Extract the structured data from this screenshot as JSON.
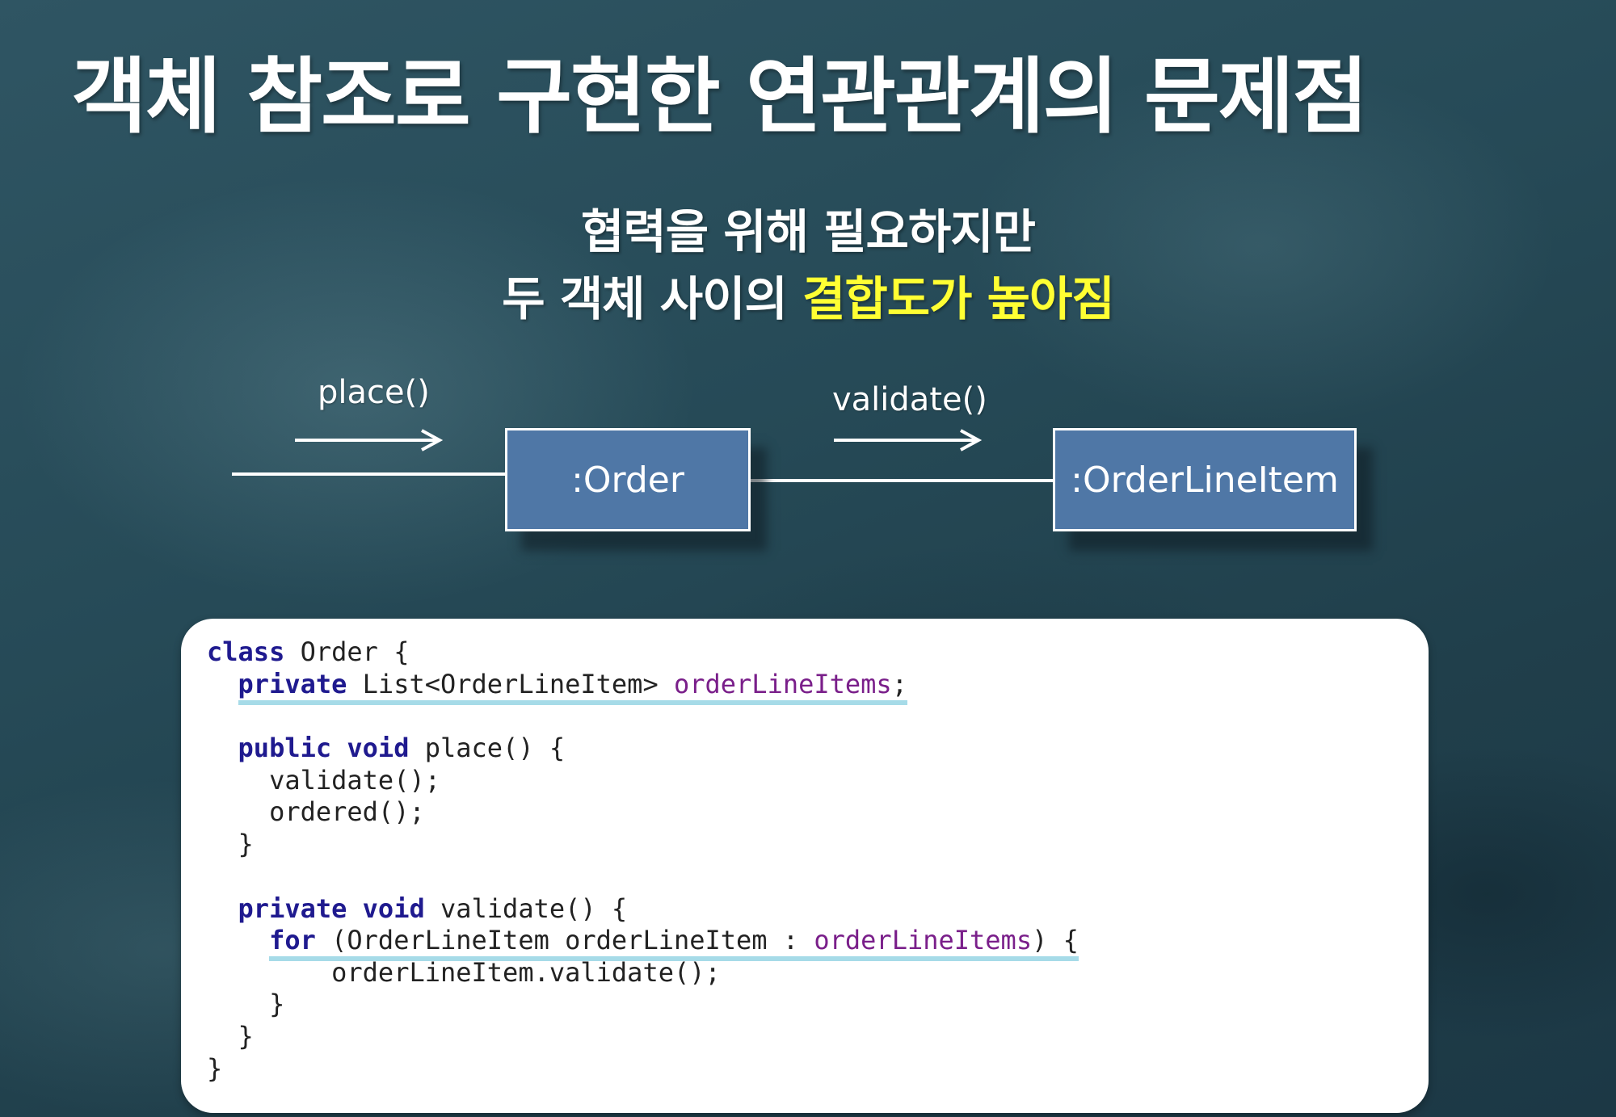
{
  "title": "객체 참조로 구현한 연관관계의 문제점",
  "subtitle": {
    "line1": "협력을 위해 필요하지만",
    "line2_prefix": "두 객체 사이의 ",
    "line2_highlight": "결합도가 높아짐"
  },
  "diagram": {
    "objects": [
      {
        "id": "order",
        "label": ":Order"
      },
      {
        "id": "orderLineItem",
        "label": ":OrderLineItem"
      }
    ],
    "messages": [
      {
        "label": "place()",
        "to": "order"
      },
      {
        "label": "validate()",
        "from": "order",
        "to": "orderLineItem"
      }
    ]
  },
  "code": {
    "line1": {
      "kw": "class",
      "text": " Order {"
    },
    "line2": {
      "kw": "private",
      "type": " List<OrderLineItem> ",
      "field": "orderLineItems",
      "end": ";"
    },
    "line3": {
      "kw1": "public",
      "kw2": "void",
      "text": " place() {"
    },
    "line4": "validate();",
    "line5": "ordered();",
    "line6": "}",
    "line7": {
      "kw1": "private",
      "kw2": "void",
      "text": " validate() {"
    },
    "line8": {
      "kw": "for",
      "mid": " (OrderLineItem orderLineItem : ",
      "field": "orderLineItems",
      "end": ") {"
    },
    "line9": "orderLineItem.validate();",
    "line10": "}",
    "line11": "}",
    "line12": "}"
  },
  "colors": {
    "keyword": "#1f1a8f",
    "field": "#7a1f8a",
    "highlight": "#ffff33",
    "box_fill": "#4f77a6",
    "underline": "#a6dbe8"
  }
}
